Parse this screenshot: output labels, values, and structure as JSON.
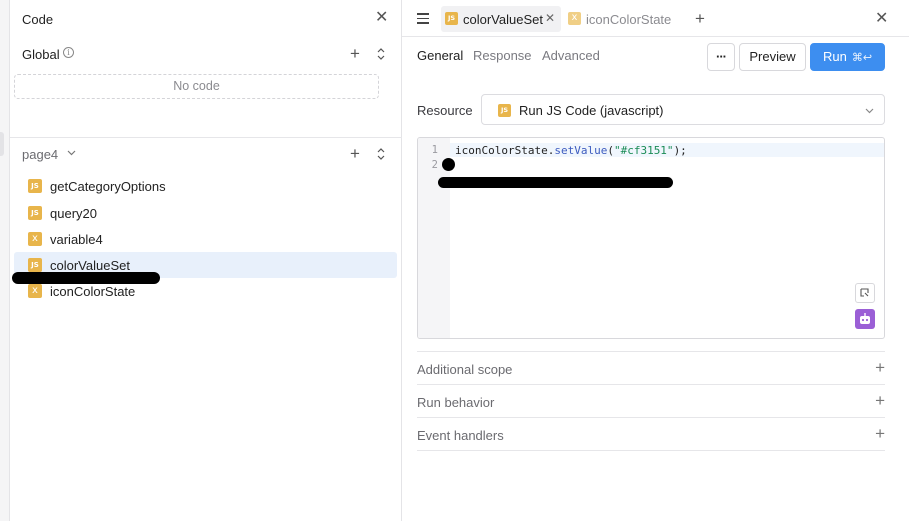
{
  "left_panel": {
    "title": "Code",
    "global": {
      "label": "Global",
      "empty_text": "No code"
    },
    "page": {
      "label": "page4"
    },
    "items": [
      {
        "label": "getCategoryOptions",
        "type": "js",
        "badge": "JS"
      },
      {
        "label": "query20",
        "type": "js",
        "badge": "JS"
      },
      {
        "label": "variable4",
        "type": "variable",
        "badge": "x"
      },
      {
        "label": "colorValueSet",
        "type": "js",
        "badge": "JS",
        "selected": true
      },
      {
        "label": "iconColorState",
        "type": "variable",
        "badge": "x"
      }
    ]
  },
  "tabs": [
    {
      "label": "colorValueSet",
      "badge": "JS",
      "active": true
    },
    {
      "label": "iconColorState",
      "badge": "x",
      "active": false
    }
  ],
  "subtabs": {
    "general": "General",
    "response": "Response",
    "advanced": "Advanced"
  },
  "toolbar": {
    "more": "···",
    "preview": "Preview",
    "run": "Run",
    "run_shortcut": "⌘↩"
  },
  "resource": {
    "label": "Resource",
    "badge": "JS",
    "value": "Run JS Code (javascript)"
  },
  "editor": {
    "line_numbers": [
      "1",
      "2"
    ],
    "line1": {
      "ident": "iconColorState",
      "dot": ".",
      "method": "setValue",
      "open": "(",
      "str": "\"#cf3151\"",
      "close": ");"
    }
  },
  "sections": [
    "Additional scope",
    "Run behavior",
    "Event handlers"
  ],
  "colors": {
    "primary": "#3d8ef0",
    "js_badge": "#e8b54b",
    "selected_row": "#e8f0fb",
    "ai_icon": "#9b5fd6"
  }
}
